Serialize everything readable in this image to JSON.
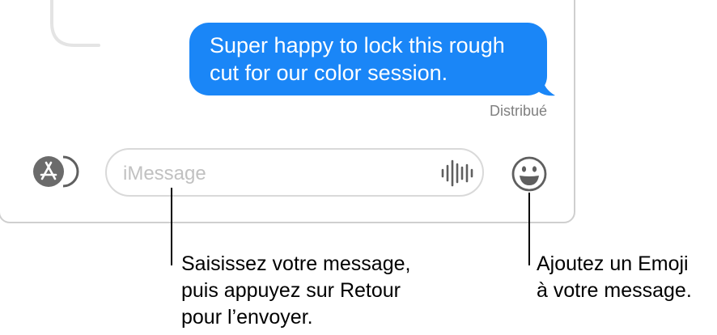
{
  "conversation": {
    "message_text": "Super happy to lock this rough cut for our color session.",
    "delivery_status": "Distribué"
  },
  "compose": {
    "placeholder": "iMessage",
    "apps_icon": "app-store-icon",
    "audio_icon": "audio-waveform-icon",
    "emoji_icon": "smiley-face-icon"
  },
  "callouts": {
    "input_help": "Saisissez votre message,\npuis appuyez sur Retour\npour l’envoyer.",
    "emoji_help": "Ajoutez un Emoji\nà votre message."
  },
  "colors": {
    "bubble": "#1a86f7",
    "window_border": "#cfcfcf",
    "icon_gray": "#5f5f5f"
  }
}
